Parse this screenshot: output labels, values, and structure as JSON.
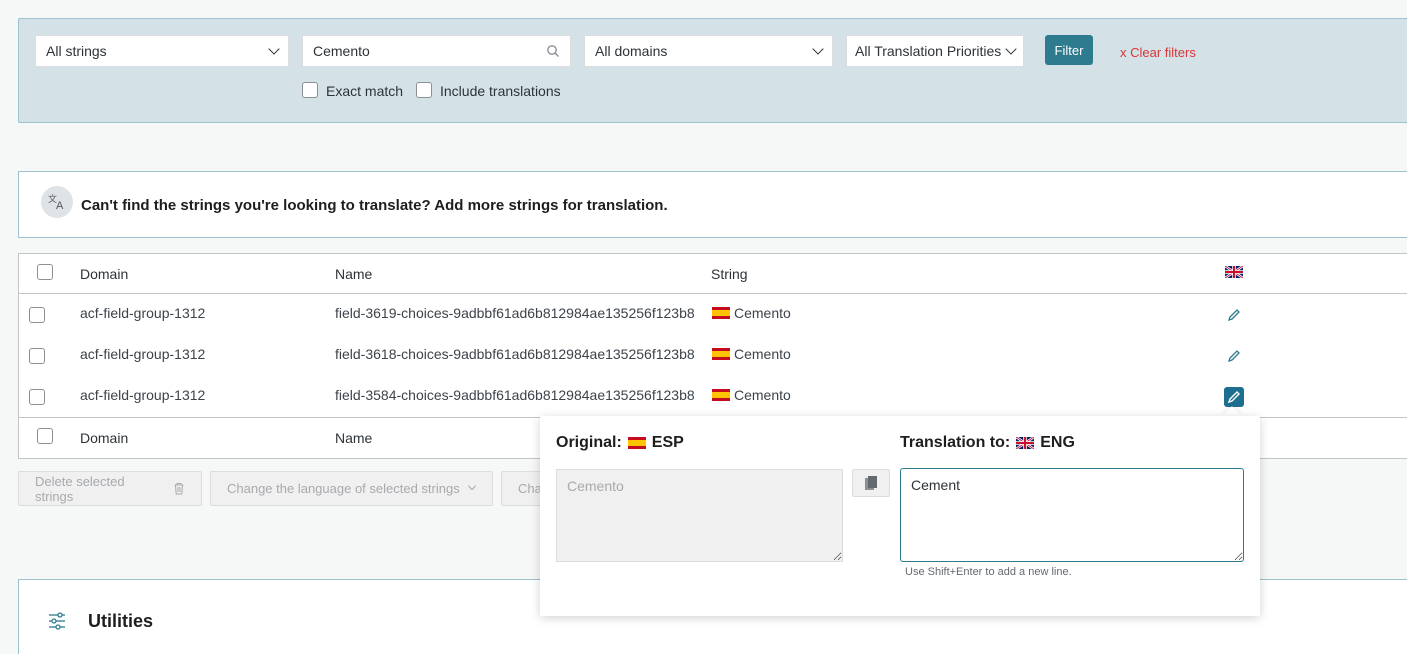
{
  "filters": {
    "strings_select": "All strings",
    "search_value": "Cemento",
    "domains_select": "All domains",
    "priorities_select": "All Translation Priorities",
    "filter_button": "Filter",
    "clear_filters": "x  Clear filters",
    "exact_match": "Exact match",
    "include_translations": "Include translations"
  },
  "notice": {
    "text": "Can't find the strings you're looking to translate? Add more strings for translation."
  },
  "table": {
    "headers": {
      "domain": "Domain",
      "name": "Name",
      "string": "String"
    },
    "rows": [
      {
        "domain": "acf-field-group-1312",
        "name": "field-3619-choices-9adbbf61ad6b812984ae135256f123b8",
        "string": "Cemento"
      },
      {
        "domain": "acf-field-group-1312",
        "name": "field-3618-choices-9adbbf61ad6b812984ae135256f123b8",
        "string": "Cemento"
      },
      {
        "domain": "acf-field-group-1312",
        "name": "field-3584-choices-9adbbf61ad6b812984ae135256f123b8",
        "string": "Cemento"
      }
    ],
    "footer": {
      "domain": "Domain",
      "name": "Name"
    }
  },
  "bulk": {
    "delete": "Delete selected strings",
    "change_language": "Change the language of selected strings",
    "third": "Cha"
  },
  "utilities": {
    "title": "Utilities"
  },
  "popup": {
    "original_label": "Original:",
    "original_lang": "ESP",
    "translation_label": "Translation to:",
    "translation_lang": "ENG",
    "original_value": "Cemento",
    "translation_value": "Cement",
    "hint": "Use Shift+Enter to add a new line."
  },
  "colors": {
    "accent": "#2e7a8e",
    "danger": "#d63638",
    "panel": "#d4e2e7"
  }
}
